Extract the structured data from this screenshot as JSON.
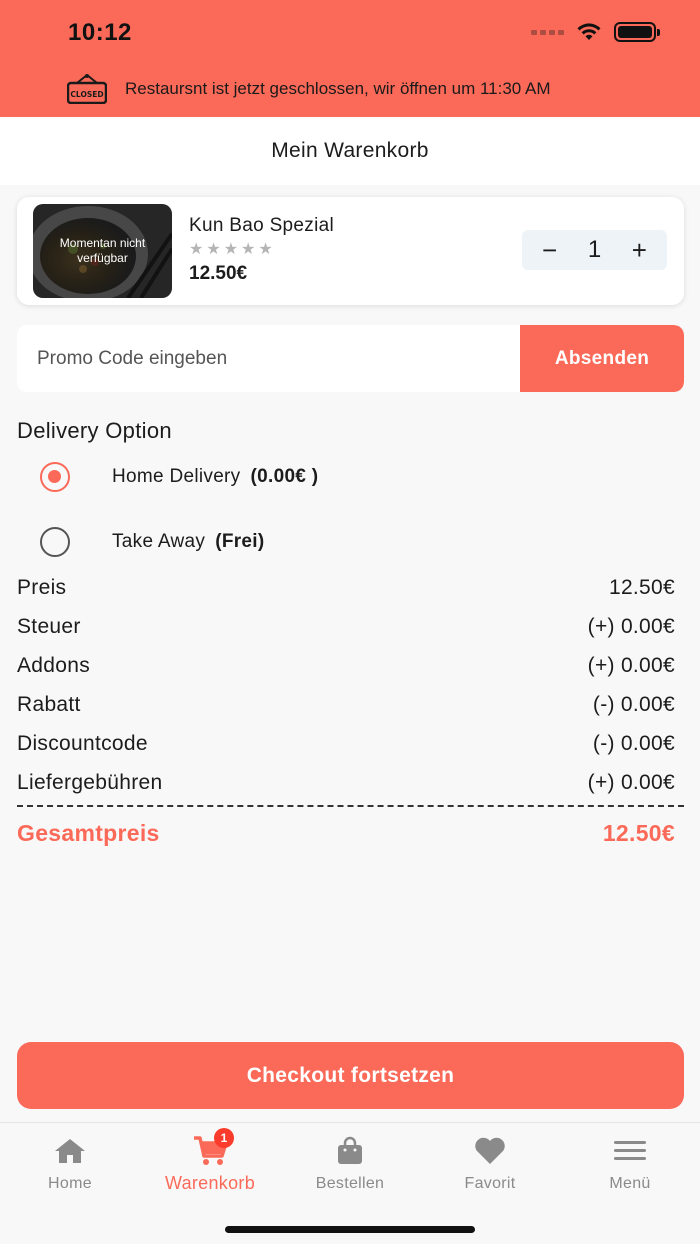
{
  "status_bar": {
    "time": "10:12"
  },
  "banner": {
    "sign_text": "CLOSED",
    "message": "Restaursnt ist jetzt geschlossen, wir öffnen um 11:30 AM"
  },
  "header": {
    "title": "Mein Warenkorb"
  },
  "cart": {
    "items": [
      {
        "name": "Kun Bao Spezial",
        "overlay": "Momentan nicht verfügbar",
        "stars": "★★★★★",
        "rating": 0,
        "price": "12.50€",
        "quantity": "1",
        "minus": "−",
        "plus": "+"
      }
    ]
  },
  "promo": {
    "placeholder": "Promo Code eingeben",
    "value": "",
    "button": "Absenden"
  },
  "delivery": {
    "title": "Delivery Option",
    "options": [
      {
        "label": "Home Delivery",
        "extra": "(0.00€ )",
        "selected": true
      },
      {
        "label": "Take Away",
        "extra": "(Frei)",
        "selected": false
      }
    ]
  },
  "summary": {
    "rows": [
      {
        "label": "Preis",
        "value": "12.50€"
      },
      {
        "label": "Steuer",
        "value": "(+) 0.00€"
      },
      {
        "label": "Addons",
        "value": "(+) 0.00€"
      },
      {
        "label": "Rabatt",
        "value": "(-) 0.00€"
      },
      {
        "label": "Discountcode",
        "value": "(-) 0.00€"
      },
      {
        "label": "Liefergebühren",
        "value": "(+) 0.00€"
      }
    ],
    "total_label": "Gesamtpreis",
    "total_value": "12.50€"
  },
  "checkout": {
    "label": "Checkout fortsetzen"
  },
  "tabbar": {
    "tabs": [
      {
        "label": "Home",
        "icon": "home-icon"
      },
      {
        "label": "Warenkorb",
        "icon": "cart-icon",
        "badge": "1",
        "active": true
      },
      {
        "label": "Bestellen",
        "icon": "shopping-bag-icon"
      },
      {
        "label": "Favorit",
        "icon": "heart-icon"
      },
      {
        "label": "Menü",
        "icon": "menu-icon"
      }
    ]
  },
  "colors": {
    "accent": "#fb6a59",
    "background": "#f8f8f8",
    "inactive": "#8a8a8a"
  }
}
